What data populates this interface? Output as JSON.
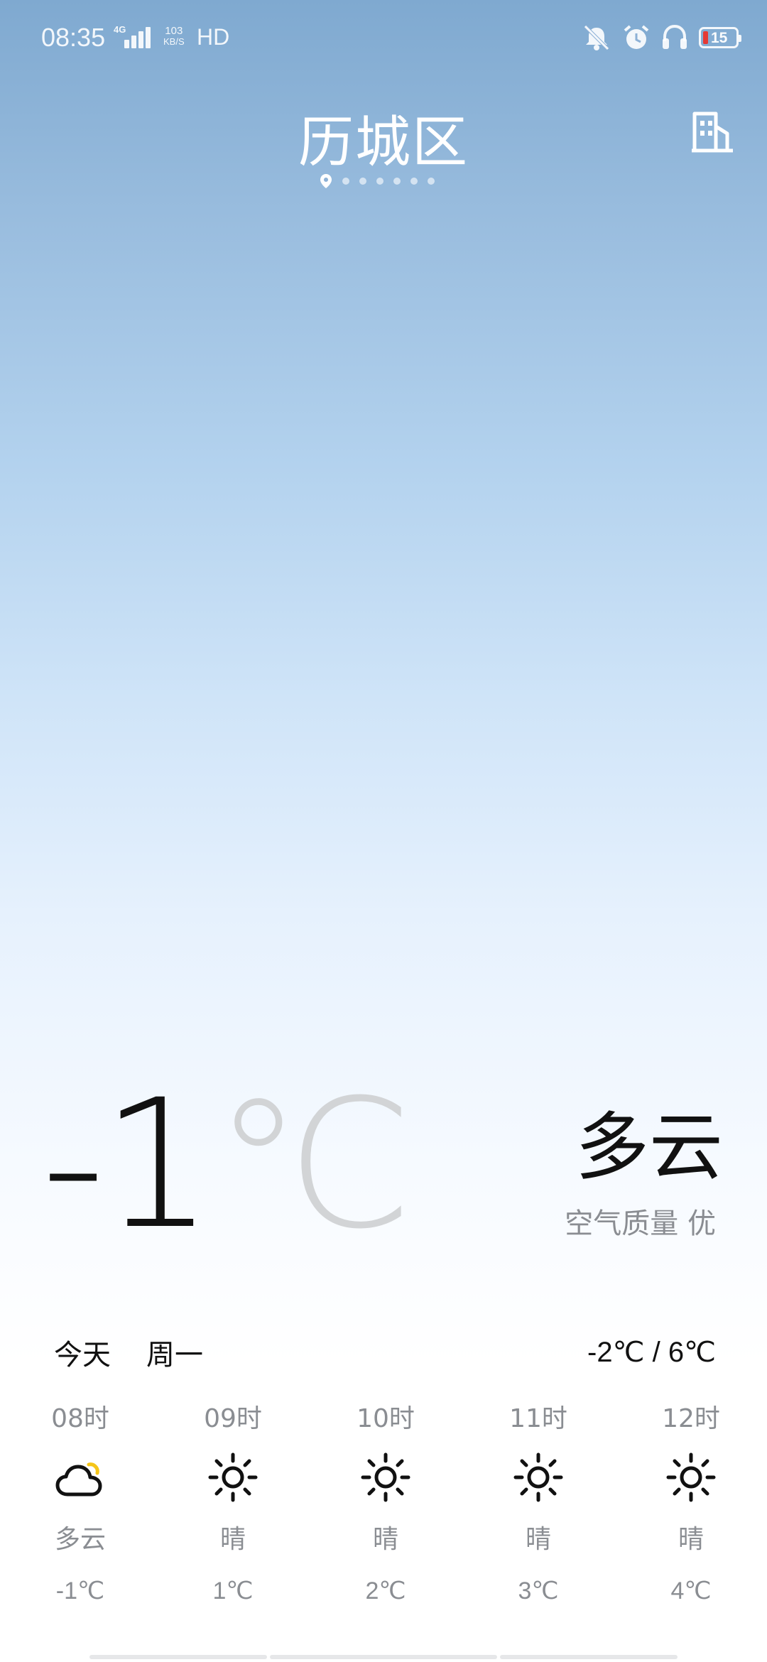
{
  "status_bar": {
    "time": "08:35",
    "network_type": "4G",
    "net_speed_value": "103",
    "net_speed_unit": "KB/S",
    "hd": "HD",
    "battery_level": "15",
    "battery_color": "#e53935",
    "icons": [
      "mute-icon",
      "alarm-icon",
      "headset-icon",
      "battery-icon"
    ]
  },
  "header": {
    "city": "历城区",
    "page_count": 7,
    "active_page": 0
  },
  "current": {
    "temperature": "-1",
    "unit": "℃",
    "condition": "多云",
    "air_quality": "空气质量 优"
  },
  "today": {
    "label": "今天",
    "weekday": "周一",
    "range": "-2℃ / 6℃"
  },
  "hourly": [
    {
      "time": "08时",
      "icon": "partly-cloudy-icon",
      "condition": "多云",
      "temp": "-1℃"
    },
    {
      "time": "09时",
      "icon": "sunny-icon",
      "condition": "晴",
      "temp": "1℃"
    },
    {
      "time": "10时",
      "icon": "sunny-icon",
      "condition": "晴",
      "temp": "2℃"
    },
    {
      "time": "11时",
      "icon": "sunny-icon",
      "condition": "晴",
      "temp": "3℃"
    },
    {
      "time": "12时",
      "icon": "sunny-icon",
      "condition": "晴",
      "temp": "4℃"
    }
  ],
  "colors": {
    "sky_top": "#7fa9d0",
    "sun_accent": "#f5c518",
    "secondary_text": "#8a8d92"
  }
}
